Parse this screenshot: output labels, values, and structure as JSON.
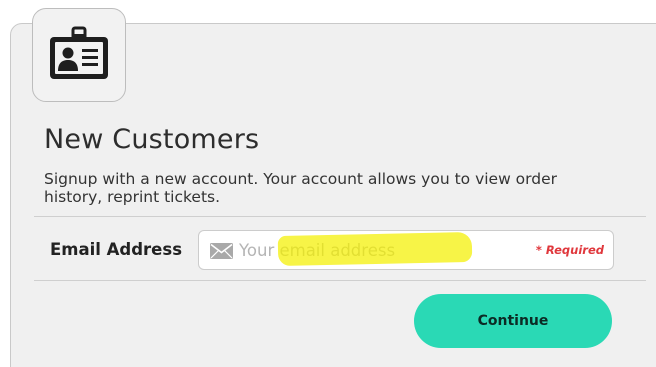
{
  "panel": {
    "title": "New Customers",
    "description": "Signup with a new account. Your account allows you to view order history, reprint tickets."
  },
  "form": {
    "email_label": "Email Address",
    "email_placeholder": "Your email address",
    "email_value": "",
    "required_text": "* Required",
    "continue_label": "Continue"
  },
  "icons": {
    "badge": "id-card-icon",
    "email": "envelope-icon"
  },
  "colors": {
    "accent": "#2ad9b5",
    "required": "#e0383d",
    "highlight": "#f4f000",
    "panel_background": "#f0f0f0"
  }
}
